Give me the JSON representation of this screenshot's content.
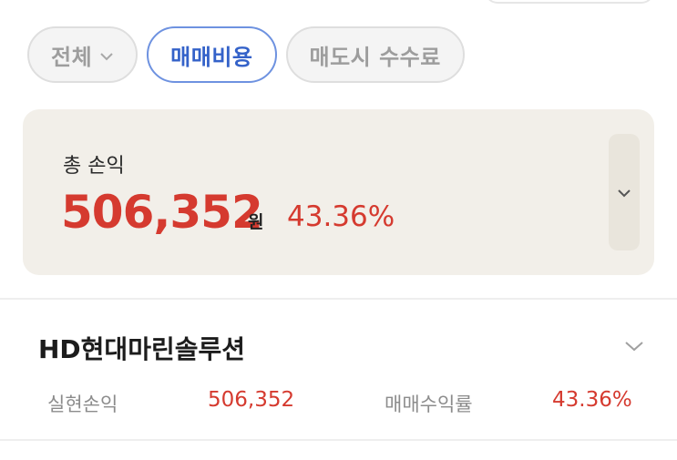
{
  "filters": [
    {
      "label": "전체",
      "has_dropdown": true,
      "active": false
    },
    {
      "label": "매매비용",
      "has_dropdown": false,
      "active": true
    },
    {
      "label": "매도시 수수료",
      "has_dropdown": false,
      "active": false
    }
  ],
  "summary": {
    "title": "총 손익",
    "amount": "506,352",
    "unit": "원",
    "rate": "43.36%"
  },
  "stock": {
    "name": "HD현대마린솔루션",
    "realized_label": "실현손익",
    "realized_value": "506,352",
    "return_label": "매매수익률",
    "return_value": "43.36%"
  },
  "colors": {
    "profit": "#d53a2f",
    "active_chip": "#3462c9",
    "card_bg": "#f2efe9"
  },
  "icons": {
    "summary_expand": "chevron-down-icon",
    "stock_expand": "chevron-down-icon",
    "filter_dropdown": "chevron-down-icon"
  }
}
